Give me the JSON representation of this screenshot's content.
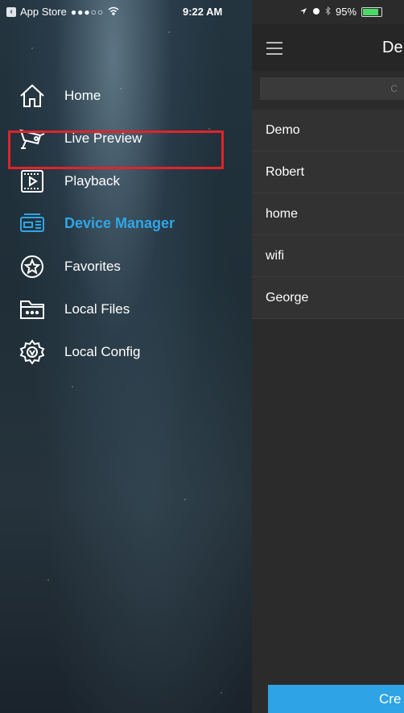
{
  "status_bar": {
    "back_app": "App Store",
    "signal": "●●●○○",
    "time": "9:22 AM",
    "battery": "95%",
    "battery_level": 0.95
  },
  "drawer": {
    "items": [
      {
        "label": "Home",
        "icon": "home-icon"
      },
      {
        "label": "Live Preview",
        "icon": "camera-icon"
      },
      {
        "label": "Playback",
        "icon": "playback-icon"
      },
      {
        "label": "Device Manager",
        "icon": "device-icon",
        "active": true
      },
      {
        "label": "Favorites",
        "icon": "star-icon"
      },
      {
        "label": "Local Files",
        "icon": "folder-icon"
      },
      {
        "label": "Local Config",
        "icon": "gear-icon"
      }
    ],
    "accent_color": "#2fa6e8",
    "highlight_color": "#e0232b"
  },
  "main": {
    "title": "De",
    "search_placeholder": "C",
    "devices": [
      "Demo",
      "Robert",
      "home",
      "wifi",
      "George"
    ],
    "create_label": "Cre",
    "button_color": "#2ea3e5"
  }
}
